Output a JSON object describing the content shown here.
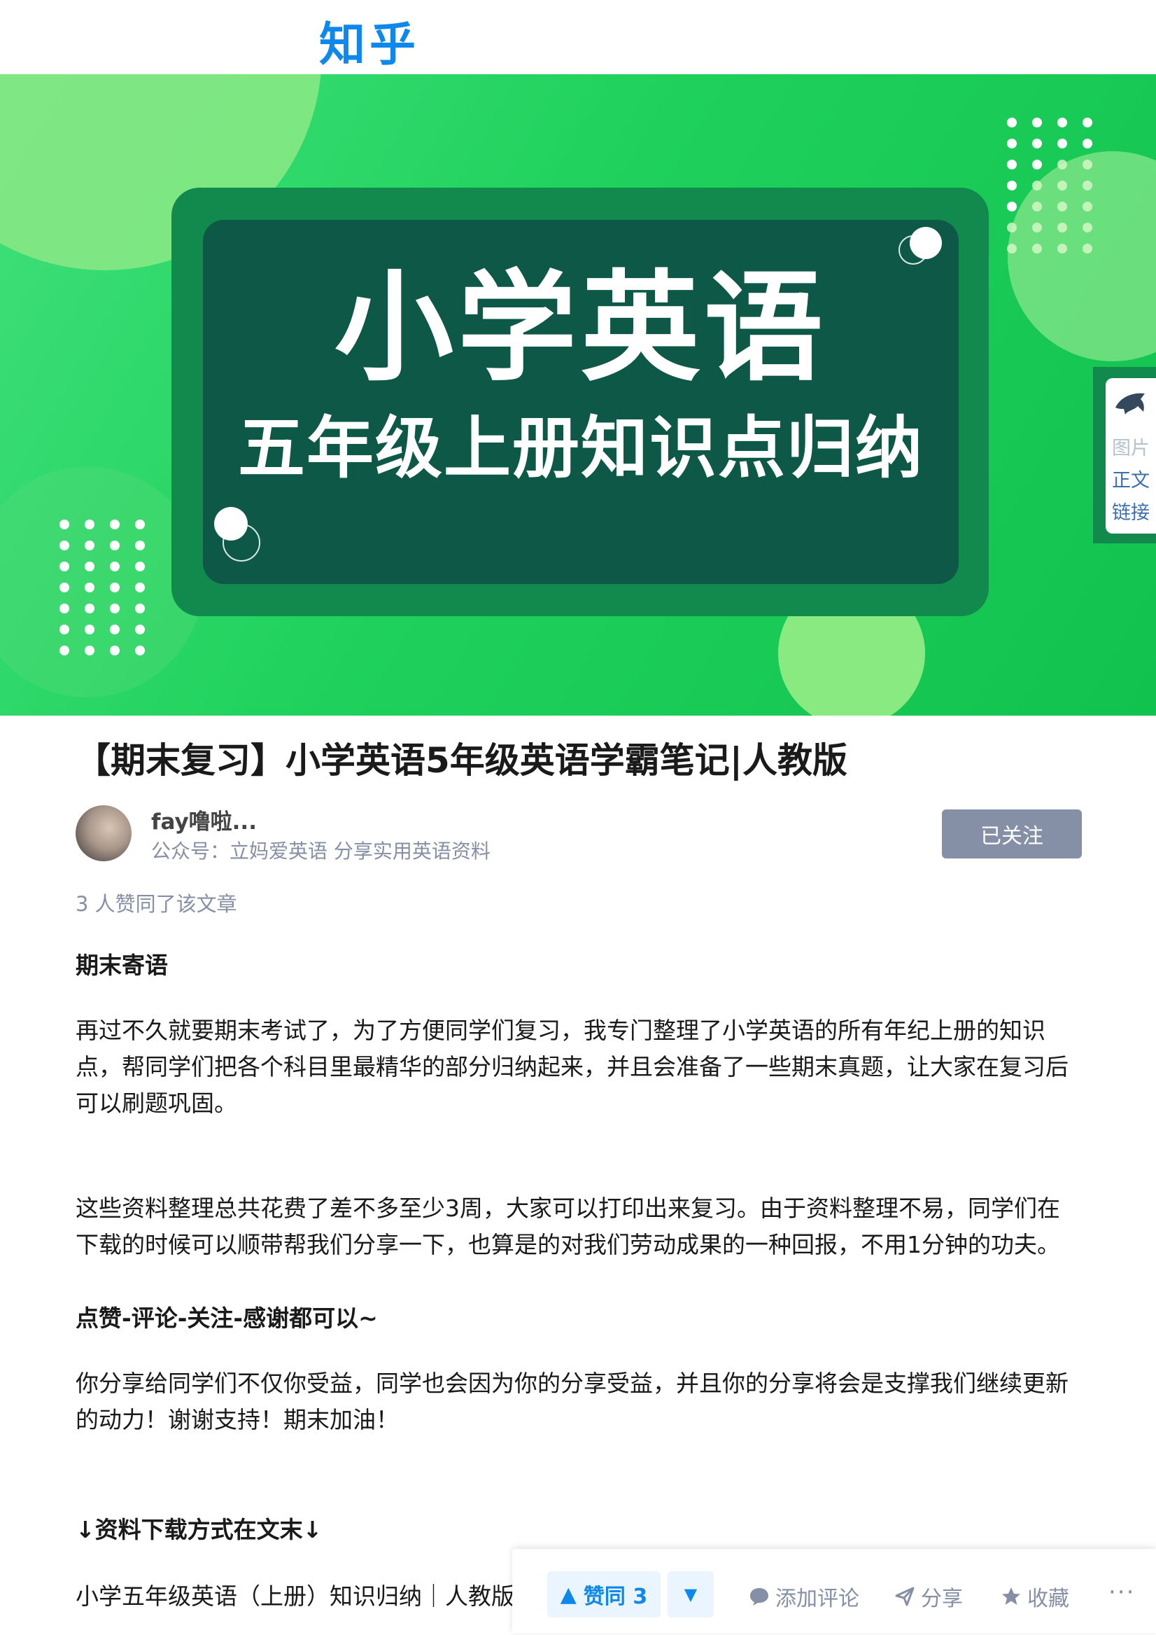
{
  "header": {
    "logo_text": "知乎"
  },
  "banner": {
    "title": "小学英语",
    "subtitle": "五年级上册知识点归纳",
    "colors": {
      "background": "#1fd15c",
      "board": "#0e5848",
      "board_frame": "#138a4d"
    }
  },
  "side_widget": {
    "icon": "shark-icon",
    "items": [
      "图片",
      "正文",
      "链接"
    ]
  },
  "article": {
    "title": "【期末复习】小学英语5年级英语学霸笔记|人教版",
    "author": {
      "name": "fay噜啦...",
      "bio": "公众号：立妈爱英语 分享实用英语资料"
    },
    "follow_label": "已关注",
    "likes_text": "3 人赞同了该文章",
    "sections": {
      "h1": "期末寄语",
      "p1": [
        "再过不久就要期末考试了，为了方便同学们复习，我专门整理了小学英语的所有年纪上册的知识",
        "点，帮同学们把各个科目里最精华的部分归纳起来，并且会准备了一些期末真题，让大家在复习后",
        "可以刷题巩固。"
      ],
      "p2": [
        "这些资料整理总共花费了差不多至少3周，大家可以打印出来复习。由于资料整理不易，同学们在",
        "下载的时候可以顺带帮我们分享一下，也算是的对我们劳动成果的一种回报，不用1分钟的功夫。"
      ],
      "h2": "点赞-评论-关注-感谢都可以~",
      "p3": [
        "你分享给同学们不仅你受益，同学也会因为你的分享受益，并且你的分享将会是支撑我们继续更新",
        "的动力！谢谢支持！期末加油！"
      ],
      "h3": "↓资料下载方式在文末↓",
      "p4": "小学五年级英语（上册）知识归纳｜人教版"
    }
  },
  "actionbar": {
    "upvote_label": "赞同 3",
    "upvote_icon": "triangle-up-icon",
    "downvote_icon": "triangle-down-icon",
    "comment_label": "添加评论",
    "share_label": "分享",
    "collect_label": "收藏",
    "more_label": "···",
    "accent_color": "#0f88eb"
  }
}
